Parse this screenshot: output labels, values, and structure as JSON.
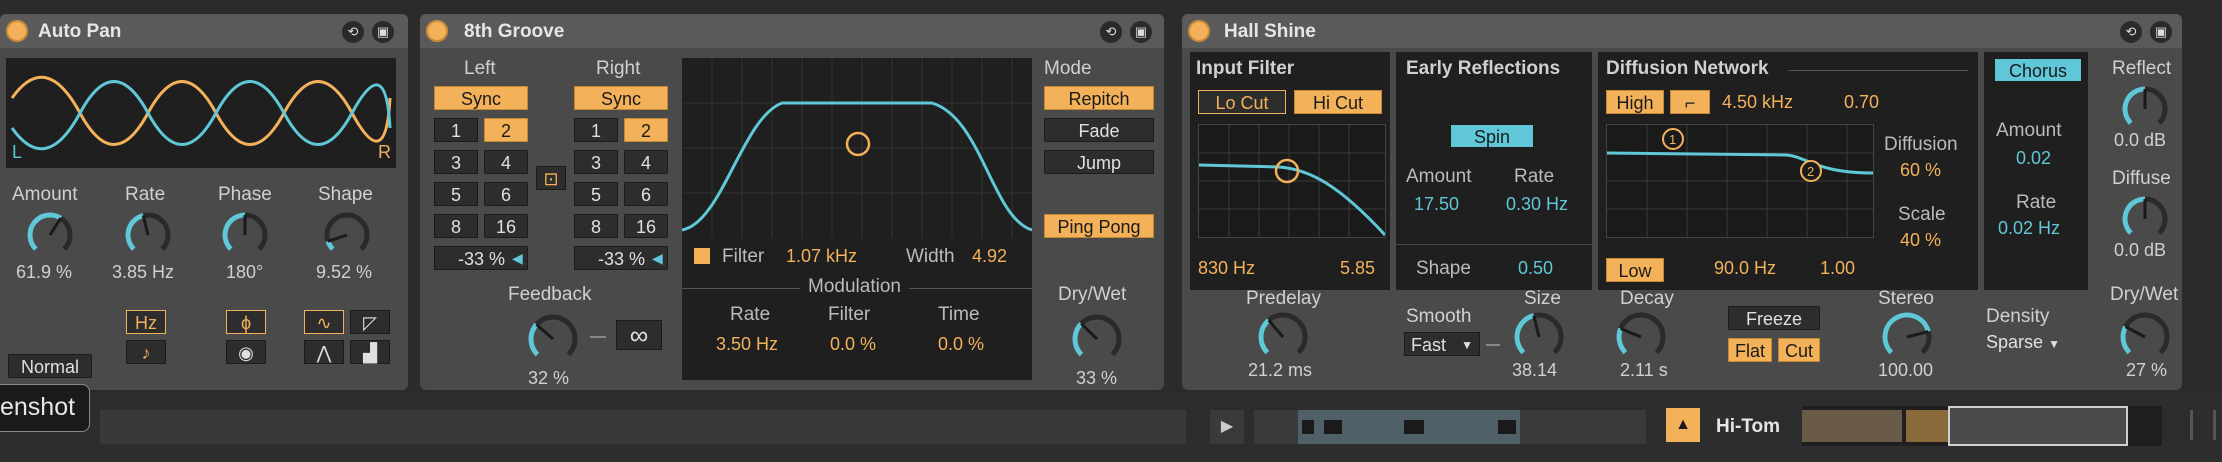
{
  "autopan": {
    "title": "Auto Pan",
    "lfo_left": "L",
    "lfo_right": "R",
    "params": [
      {
        "label": "Amount",
        "value": "61.9 %",
        "level": 0.62
      },
      {
        "label": "Rate",
        "value": "3.85 Hz",
        "level": 0.45
      },
      {
        "label": "Phase",
        "value": "180°",
        "level": 0.5
      },
      {
        "label": "Shape",
        "value": "9.52 %",
        "level": 0.1
      }
    ],
    "hz_label": "Hz",
    "note_label": "♪",
    "phi_label": "ϕ",
    "mode_select": "Normal"
  },
  "groove": {
    "title": "8th Groove",
    "left_label": "Left",
    "right_label": "Right",
    "sync_label": "Sync",
    "divisions": [
      "1",
      "2",
      "3",
      "4",
      "5",
      "6",
      "8",
      "16"
    ],
    "left_selected": "2",
    "right_selected": "2",
    "left_offset": "-33 %",
    "right_offset": "-33 %",
    "link_icon": "link-icon",
    "filter_label": "Filter",
    "filter_value": "1.07 kHz",
    "width_label": "Width",
    "width_value": "4.92",
    "modulation_label": "Modulation",
    "mod_rate_label": "Rate",
    "mod_rate_value": "3.50 Hz",
    "mod_filter_label": "Filter",
    "mod_filter_value": "0.0 %",
    "mod_time_label": "Time",
    "mod_time_value": "0.0 %",
    "feedback_label": "Feedback",
    "feedback_value": "32 %",
    "feedback_level": 0.32,
    "freeze_icon": "∞",
    "mode_label": "Mode",
    "modes": [
      "Repitch",
      "Fade",
      "Jump"
    ],
    "mode_selected": "Repitch",
    "pingpong_label": "Ping Pong",
    "drywet_label": "Dry/Wet",
    "drywet_value": "33 %",
    "drywet_level": 0.33
  },
  "hall": {
    "title": "Hall Shine",
    "input_filter_label": "Input Filter",
    "locut_label": "Lo Cut",
    "hicut_label": "Hi Cut",
    "filter_freq": "830 Hz",
    "filter_width": "5.85",
    "early_label": "Early Reflections",
    "spin_label": "Spin",
    "er_amount_label": "Amount",
    "er_amount_value": "17.50",
    "er_rate_label": "Rate",
    "er_rate_value": "0.30 Hz",
    "shape_label": "Shape",
    "shape_value": "0.50",
    "diffusion_label": "Diffusion Network",
    "high_label": "High",
    "high_freq": "4.50 kHz",
    "high_value": "0.70",
    "diff_label": "Diffusion",
    "diff_value": "60 %",
    "scale_label": "Scale",
    "scale_value": "40 %",
    "low_label": "Low",
    "low_freq": "90.0 Hz",
    "low_value": "1.00",
    "chorus_label": "Chorus",
    "ch_amount_label": "Amount",
    "ch_amount_value": "0.02",
    "ch_rate_label": "Rate",
    "ch_rate_value": "0.02 Hz",
    "reflect_label": "Reflect",
    "reflect_value": "0.0 dB",
    "reflect_level": 0.5,
    "diffuse_label": "Diffuse",
    "diffuse_value": "0.0 dB",
    "diffuse_level": 0.5,
    "predelay_label": "Predelay",
    "predelay_value": "21.2 ms",
    "predelay_level": 0.35,
    "smooth_label": "Smooth",
    "smooth_value": "Fast",
    "size_label": "Size",
    "size_value": "38.14",
    "size_level": 0.45,
    "decay_label": "Decay",
    "decay_value": "2.11 s",
    "decay_level": 0.25,
    "freeze_label": "Freeze",
    "flat_label": "Flat",
    "cut_label": "Cut",
    "stereo_label": "Stereo",
    "stereo_value": "100.00",
    "stereo_level": 0.78,
    "density_label": "Density",
    "density_value": "Sparse",
    "drywet_label": "Dry/Wet",
    "drywet_value": "27 %",
    "drywet_level": 0.27
  },
  "bottom": {
    "tooltip": "enshot",
    "track_name": "Hi-Tom"
  },
  "colors": {
    "accent": "#f3b15a",
    "cyan": "#5fc7d8",
    "panel": "#1f1f1f"
  }
}
